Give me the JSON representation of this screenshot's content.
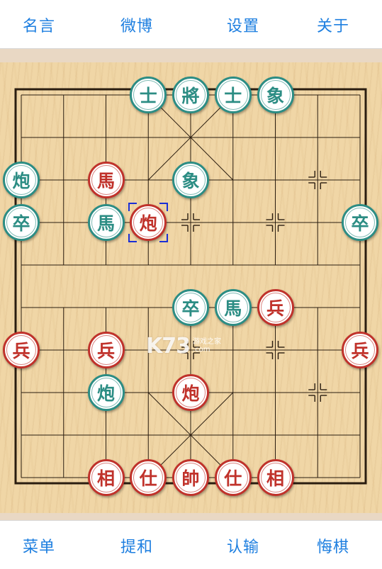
{
  "top_menu": {
    "quotes": "名言",
    "weibo": "微博",
    "settings": "设置",
    "about": "关于"
  },
  "bottom_menu": {
    "menu": "菜单",
    "draw": "提和",
    "resign": "认输",
    "undo": "悔棋"
  },
  "watermark": {
    "logo": "K73",
    "name": "游戏之家",
    "url": ".com"
  },
  "colors": {
    "accent": "#1e7fe0",
    "red_piece": "#c0322b",
    "green_piece": "#2c8d84",
    "selection": "#1a2fd6"
  },
  "board": {
    "files": 9,
    "ranks": 10,
    "selected": {
      "col": 3,
      "row": 3
    },
    "pieces": [
      {
        "side": "green",
        "label": "士",
        "col": 3,
        "row": 0
      },
      {
        "side": "green",
        "label": "將",
        "col": 4,
        "row": 0
      },
      {
        "side": "green",
        "label": "士",
        "col": 5,
        "row": 0
      },
      {
        "side": "green",
        "label": "象",
        "col": 6,
        "row": 0
      },
      {
        "side": "green",
        "label": "炮",
        "col": 0,
        "row": 2
      },
      {
        "side": "red",
        "label": "馬",
        "col": 2,
        "row": 2
      },
      {
        "side": "green",
        "label": "象",
        "col": 4,
        "row": 2
      },
      {
        "side": "green",
        "label": "卒",
        "col": 0,
        "row": 3
      },
      {
        "side": "green",
        "label": "馬",
        "col": 2,
        "row": 3
      },
      {
        "side": "red",
        "label": "炮",
        "col": 3,
        "row": 3
      },
      {
        "side": "green",
        "label": "卒",
        "col": 8,
        "row": 3
      },
      {
        "side": "green",
        "label": "卒",
        "col": 4,
        "row": 5
      },
      {
        "side": "green",
        "label": "馬",
        "col": 5,
        "row": 5
      },
      {
        "side": "red",
        "label": "兵",
        "col": 6,
        "row": 5
      },
      {
        "side": "red",
        "label": "兵",
        "col": 0,
        "row": 6
      },
      {
        "side": "red",
        "label": "兵",
        "col": 2,
        "row": 6
      },
      {
        "side": "red",
        "label": "兵",
        "col": 8,
        "row": 6
      },
      {
        "side": "green",
        "label": "炮",
        "col": 2,
        "row": 7
      },
      {
        "side": "red",
        "label": "炮",
        "col": 4,
        "row": 7
      },
      {
        "side": "red",
        "label": "相",
        "col": 2,
        "row": 9
      },
      {
        "side": "red",
        "label": "仕",
        "col": 3,
        "row": 9
      },
      {
        "side": "red",
        "label": "帥",
        "col": 4,
        "row": 9
      },
      {
        "side": "red",
        "label": "仕",
        "col": 5,
        "row": 9
      },
      {
        "side": "red",
        "label": "相",
        "col": 6,
        "row": 9
      }
    ],
    "position_marks": [
      {
        "col": 2,
        "row": 2
      },
      {
        "col": 7,
        "row": 2
      },
      {
        "col": 0,
        "row": 3
      },
      {
        "col": 2,
        "row": 3
      },
      {
        "col": 4,
        "row": 3
      },
      {
        "col": 6,
        "row": 3
      },
      {
        "col": 8,
        "row": 3
      },
      {
        "col": 0,
        "row": 6
      },
      {
        "col": 2,
        "row": 6
      },
      {
        "col": 4,
        "row": 6
      },
      {
        "col": 6,
        "row": 6
      },
      {
        "col": 8,
        "row": 6
      },
      {
        "col": 2,
        "row": 7
      },
      {
        "col": 7,
        "row": 7
      }
    ]
  }
}
